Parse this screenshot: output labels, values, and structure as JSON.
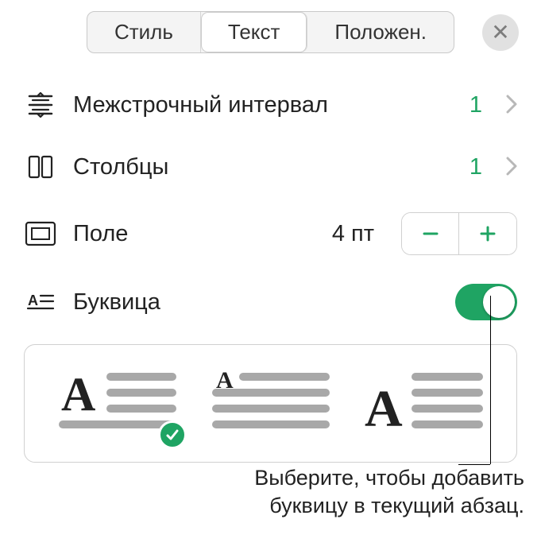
{
  "tabs": {
    "style": "Стиль",
    "text": "Текст",
    "position": "Положен."
  },
  "rows": {
    "line_spacing": {
      "label": "Межстрочный интервал",
      "value": "1"
    },
    "columns": {
      "label": "Столбцы",
      "value": "1"
    },
    "margin": {
      "label": "Поле",
      "value": "4 пт"
    },
    "dropcap": {
      "label": "Буквица"
    }
  },
  "callout": {
    "line1": "Выберите, чтобы добавить",
    "line2": "буквицу в текущий абзац."
  },
  "colors": {
    "accent": "#1fa463"
  }
}
